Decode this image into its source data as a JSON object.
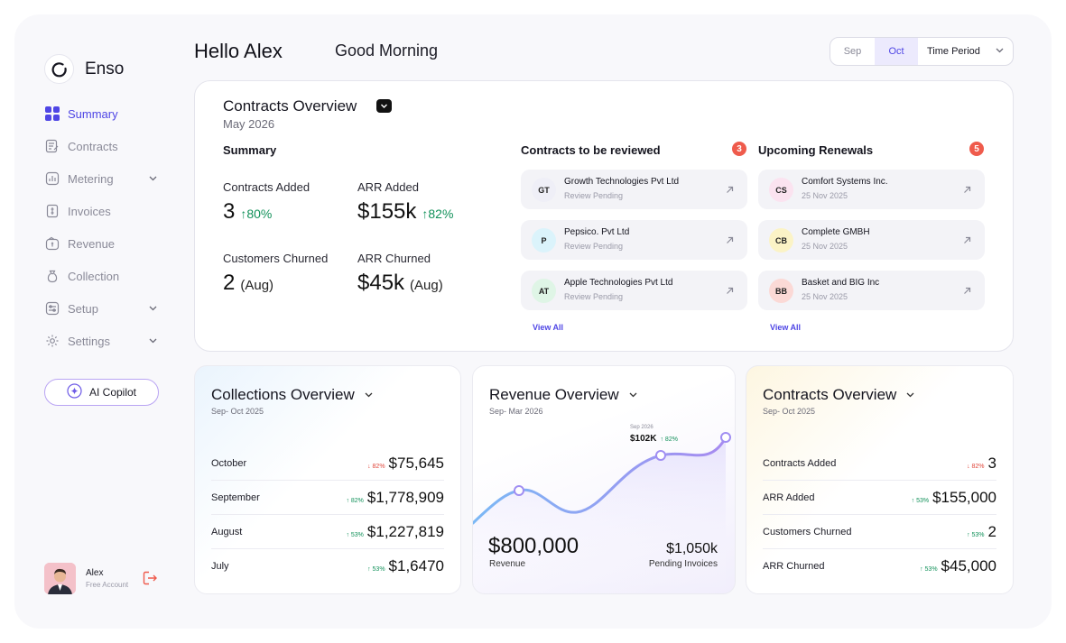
{
  "app": {
    "name": "Enso"
  },
  "sidebar": {
    "items": [
      {
        "label": "Summary",
        "icon": "grid-icon",
        "active": true
      },
      {
        "label": "Contracts",
        "icon": "contract-icon"
      },
      {
        "label": "Metering",
        "icon": "bar-chart-icon",
        "expandable": true
      },
      {
        "label": "Invoices",
        "icon": "invoice-icon"
      },
      {
        "label": "Revenue",
        "icon": "wallet-icon"
      },
      {
        "label": "Collection",
        "icon": "money-bag-icon"
      },
      {
        "label": "Setup",
        "icon": "sliders-icon",
        "expandable": true
      },
      {
        "label": "Settings",
        "icon": "gear-icon",
        "expandable": true
      }
    ],
    "copilot_label": "AI Copilot",
    "user": {
      "name": "Alex",
      "plan": "Free Account"
    }
  },
  "header": {
    "hello": "Hello Alex",
    "greeting": "Good Morning",
    "period": {
      "options": [
        "Sep",
        "Oct"
      ],
      "selected": "Oct",
      "label": "Time Period"
    }
  },
  "contracts_overview": {
    "title": "Contracts Overview",
    "date": "May 2026",
    "summary_heading": "Summary",
    "stats": [
      {
        "label": "Contracts  Added",
        "value": "3",
        "change": "80%",
        "suffix": ""
      },
      {
        "label": "ARR Added",
        "value": "$155k",
        "change": "82%",
        "suffix": ""
      },
      {
        "label": "Customers Churned",
        "value": "2",
        "change": "",
        "suffix": "(Aug)"
      },
      {
        "label": "ARR Churned",
        "value": "$45k",
        "change": "",
        "suffix": "(Aug)"
      }
    ],
    "review": {
      "heading": "Contracts to be reviewed",
      "count": "3",
      "items": [
        {
          "initials": "GT",
          "name": "Growth Technologies Pvt Ltd",
          "status": "Review Pending",
          "color": "#efeff7"
        },
        {
          "initials": "P",
          "name": "Pepsico. Pvt Ltd",
          "status": "Review Pending",
          "color": "#dbf3fb"
        },
        {
          "initials": "AT",
          "name": "Apple Technologies Pvt Ltd",
          "status": "Review Pending",
          "color": "#dff5e6"
        }
      ],
      "view_all": "View All"
    },
    "renewals": {
      "heading": "Upcoming Renewals",
      "count": "5",
      "items": [
        {
          "initials": "CS",
          "name": "Comfort Systems Inc.",
          "status": "25 Nov 2025",
          "color": "#fbe3f0"
        },
        {
          "initials": "CB",
          "name": "Complete GMBH",
          "status": "25 Nov 2025",
          "color": "#fbf3c6"
        },
        {
          "initials": "BB",
          "name": "Basket and BIG Inc",
          "status": "25 Nov 2025",
          "color": "#fbd9d6"
        }
      ],
      "view_all": "View All"
    }
  },
  "collections": {
    "title": "Collections Overview",
    "subtitle": "Sep- Oct 2025",
    "rows": [
      {
        "name": "October",
        "change": "82%",
        "dir": "down",
        "amount": "$75,645"
      },
      {
        "name": "September",
        "change": "82%",
        "dir": "up",
        "amount": "$1,778,909"
      },
      {
        "name": "August",
        "change": "53%",
        "dir": "up",
        "amount": "$1,227,819"
      },
      {
        "name": "July",
        "change": "53%",
        "dir": "up",
        "amount": "$1,6470"
      }
    ]
  },
  "revenue": {
    "title": "Revenue Overview",
    "subtitle": "Sep- Mar 2026",
    "tooltip": {
      "date": "Sep 2026",
      "value": "$102K",
      "change": "82%"
    },
    "total": "$800,000",
    "total_label": "Revenue",
    "pending": "$1,050k",
    "pending_label": "Pending Invoices"
  },
  "contracts_small": {
    "title": "Contracts Overview",
    "subtitle": "Sep- Oct 2025",
    "rows": [
      {
        "name": "Contracts  Added",
        "change": "82%",
        "dir": "down",
        "amount": "3"
      },
      {
        "name": "ARR Added",
        "change": "53%",
        "dir": "up",
        "amount": "$155,000"
      },
      {
        "name": "Customers Churned",
        "change": "53%",
        "dir": "up",
        "amount": "2"
      },
      {
        "name": "ARR Churned",
        "change": "53%",
        "dir": "up",
        "amount": "$45,000"
      }
    ]
  },
  "colors": {
    "accent": "#4f46e5",
    "up": "#12915a",
    "down": "#e0473b",
    "badge": "#ef5b4c"
  }
}
